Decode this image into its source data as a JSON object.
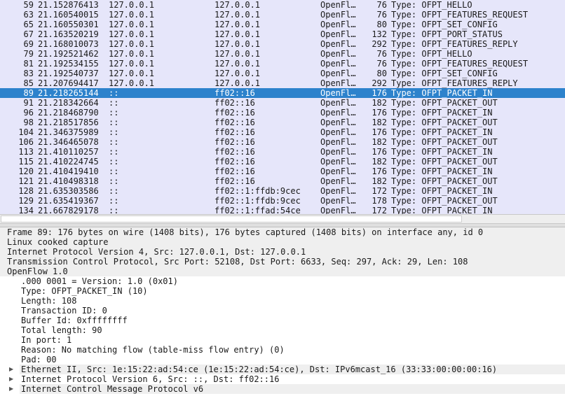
{
  "packets": [
    {
      "no": "59",
      "time": "21.152876413",
      "src": "127.0.0.1",
      "dst": "127.0.0.1",
      "proto": "OpenFl…",
      "len": "76",
      "info": "Type: OFPT_HELLO"
    },
    {
      "no": "63",
      "time": "21.160540015",
      "src": "127.0.0.1",
      "dst": "127.0.0.1",
      "proto": "OpenFl…",
      "len": "76",
      "info": "Type: OFPT_FEATURES_REQUEST"
    },
    {
      "no": "65",
      "time": "21.160550301",
      "src": "127.0.0.1",
      "dst": "127.0.0.1",
      "proto": "OpenFl…",
      "len": "80",
      "info": "Type: OFPT_SET_CONFIG"
    },
    {
      "no": "67",
      "time": "21.163520219",
      "src": "127.0.0.1",
      "dst": "127.0.0.1",
      "proto": "OpenFl…",
      "len": "132",
      "info": "Type: OFPT_PORT_STATUS"
    },
    {
      "no": "69",
      "time": "21.168010073",
      "src": "127.0.0.1",
      "dst": "127.0.0.1",
      "proto": "OpenFl…",
      "len": "292",
      "info": "Type: OFPT_FEATURES_REPLY"
    },
    {
      "no": "79",
      "time": "21.192521462",
      "src": "127.0.0.1",
      "dst": "127.0.0.1",
      "proto": "OpenFl…",
      "len": "76",
      "info": "Type: OFPT_HELLO"
    },
    {
      "no": "81",
      "time": "21.192534155",
      "src": "127.0.0.1",
      "dst": "127.0.0.1",
      "proto": "OpenFl…",
      "len": "76",
      "info": "Type: OFPT_FEATURES_REQUEST"
    },
    {
      "no": "83",
      "time": "21.192540737",
      "src": "127.0.0.1",
      "dst": "127.0.0.1",
      "proto": "OpenFl…",
      "len": "80",
      "info": "Type: OFPT_SET_CONFIG"
    },
    {
      "no": "85",
      "time": "21.207694417",
      "src": "127.0.0.1",
      "dst": "127.0.0.1",
      "proto": "OpenFl…",
      "len": "292",
      "info": "Type: OFPT_FEATURES_REPLY"
    },
    {
      "no": "89",
      "time": "21.218265144",
      "src": "::",
      "dst": "ff02::16",
      "proto": "OpenFl…",
      "len": "176",
      "info": "Type: OFPT_PACKET_IN",
      "selected": true
    },
    {
      "no": "91",
      "time": "21.218342664",
      "src": "::",
      "dst": "ff02::16",
      "proto": "OpenFl…",
      "len": "182",
      "info": "Type: OFPT_PACKET_OUT"
    },
    {
      "no": "96",
      "time": "21.218468790",
      "src": "::",
      "dst": "ff02::16",
      "proto": "OpenFl…",
      "len": "176",
      "info": "Type: OFPT_PACKET_IN"
    },
    {
      "no": "98",
      "time": "21.218517856",
      "src": "::",
      "dst": "ff02::16",
      "proto": "OpenFl…",
      "len": "182",
      "info": "Type: OFPT_PACKET_OUT"
    },
    {
      "no": "104",
      "time": "21.346375989",
      "src": "::",
      "dst": "ff02::16",
      "proto": "OpenFl…",
      "len": "176",
      "info": "Type: OFPT_PACKET_IN"
    },
    {
      "no": "106",
      "time": "21.346465078",
      "src": "::",
      "dst": "ff02::16",
      "proto": "OpenFl…",
      "len": "182",
      "info": "Type: OFPT_PACKET_OUT"
    },
    {
      "no": "113",
      "time": "21.410110257",
      "src": "::",
      "dst": "ff02::16",
      "proto": "OpenFl…",
      "len": "176",
      "info": "Type: OFPT_PACKET_IN"
    },
    {
      "no": "115",
      "time": "21.410224745",
      "src": "::",
      "dst": "ff02::16",
      "proto": "OpenFl…",
      "len": "182",
      "info": "Type: OFPT_PACKET_OUT"
    },
    {
      "no": "120",
      "time": "21.410419410",
      "src": "::",
      "dst": "ff02::16",
      "proto": "OpenFl…",
      "len": "176",
      "info": "Type: OFPT_PACKET_IN"
    },
    {
      "no": "121",
      "time": "21.410498318",
      "src": "::",
      "dst": "ff02::16",
      "proto": "OpenFl…",
      "len": "182",
      "info": "Type: OFPT_PACKET_OUT"
    },
    {
      "no": "128",
      "time": "21.635303586",
      "src": "::",
      "dst": "ff02::1:ffdb:9cec",
      "proto": "OpenFl…",
      "len": "172",
      "info": "Type: OFPT_PACKET_IN"
    },
    {
      "no": "129",
      "time": "21.635419367",
      "src": "::",
      "dst": "ff02::1:ffdb:9cec",
      "proto": "OpenFl…",
      "len": "178",
      "info": "Type: OFPT_PACKET_OUT"
    },
    {
      "no": "134",
      "time": "21.667829178",
      "src": "::",
      "dst": "ff02::1:ffad:54ce",
      "proto": "OpenFl…",
      "len": "172",
      "info": "Type: OFPT_PACKET_IN"
    }
  ],
  "details": {
    "frame": "Frame 89: 176 bytes on wire (1408 bits), 176 bytes captured (1408 bits) on interface any, id 0",
    "linux_cooked": "Linux cooked capture",
    "ipv4": "Internet Protocol Version 4, Src: 127.0.0.1, Dst: 127.0.0.1",
    "tcp": "Transmission Control Protocol, Src Port: 52108, Dst Port: 6633, Seq: 297, Ack: 29, Len: 108",
    "openflow": "OpenFlow 1.0",
    "openflow_fields": [
      ".000 0001 = Version: 1.0 (0x01)",
      "Type: OFPT_PACKET_IN (10)",
      "Length: 108",
      "Transaction ID: 0",
      "Buffer Id: 0xffffffff",
      "Total length: 90",
      "In port: 1",
      "Reason: No matching flow (table-miss flow entry) (0)",
      "Pad: 00"
    ],
    "ethernet": "Ethernet II, Src: 1e:15:22:ad:54:ce (1e:15:22:ad:54:ce), Dst: IPv6mcast_16 (33:33:00:00:00:16)",
    "ipv6": "Internet Protocol Version 6, Src: ::, Dst: ff02::16",
    "icmpv6": "Internet Control Message Protocol v6"
  },
  "colors": {
    "openflow_row": "#e6e6fa",
    "selected_row": "#2d82cc"
  }
}
